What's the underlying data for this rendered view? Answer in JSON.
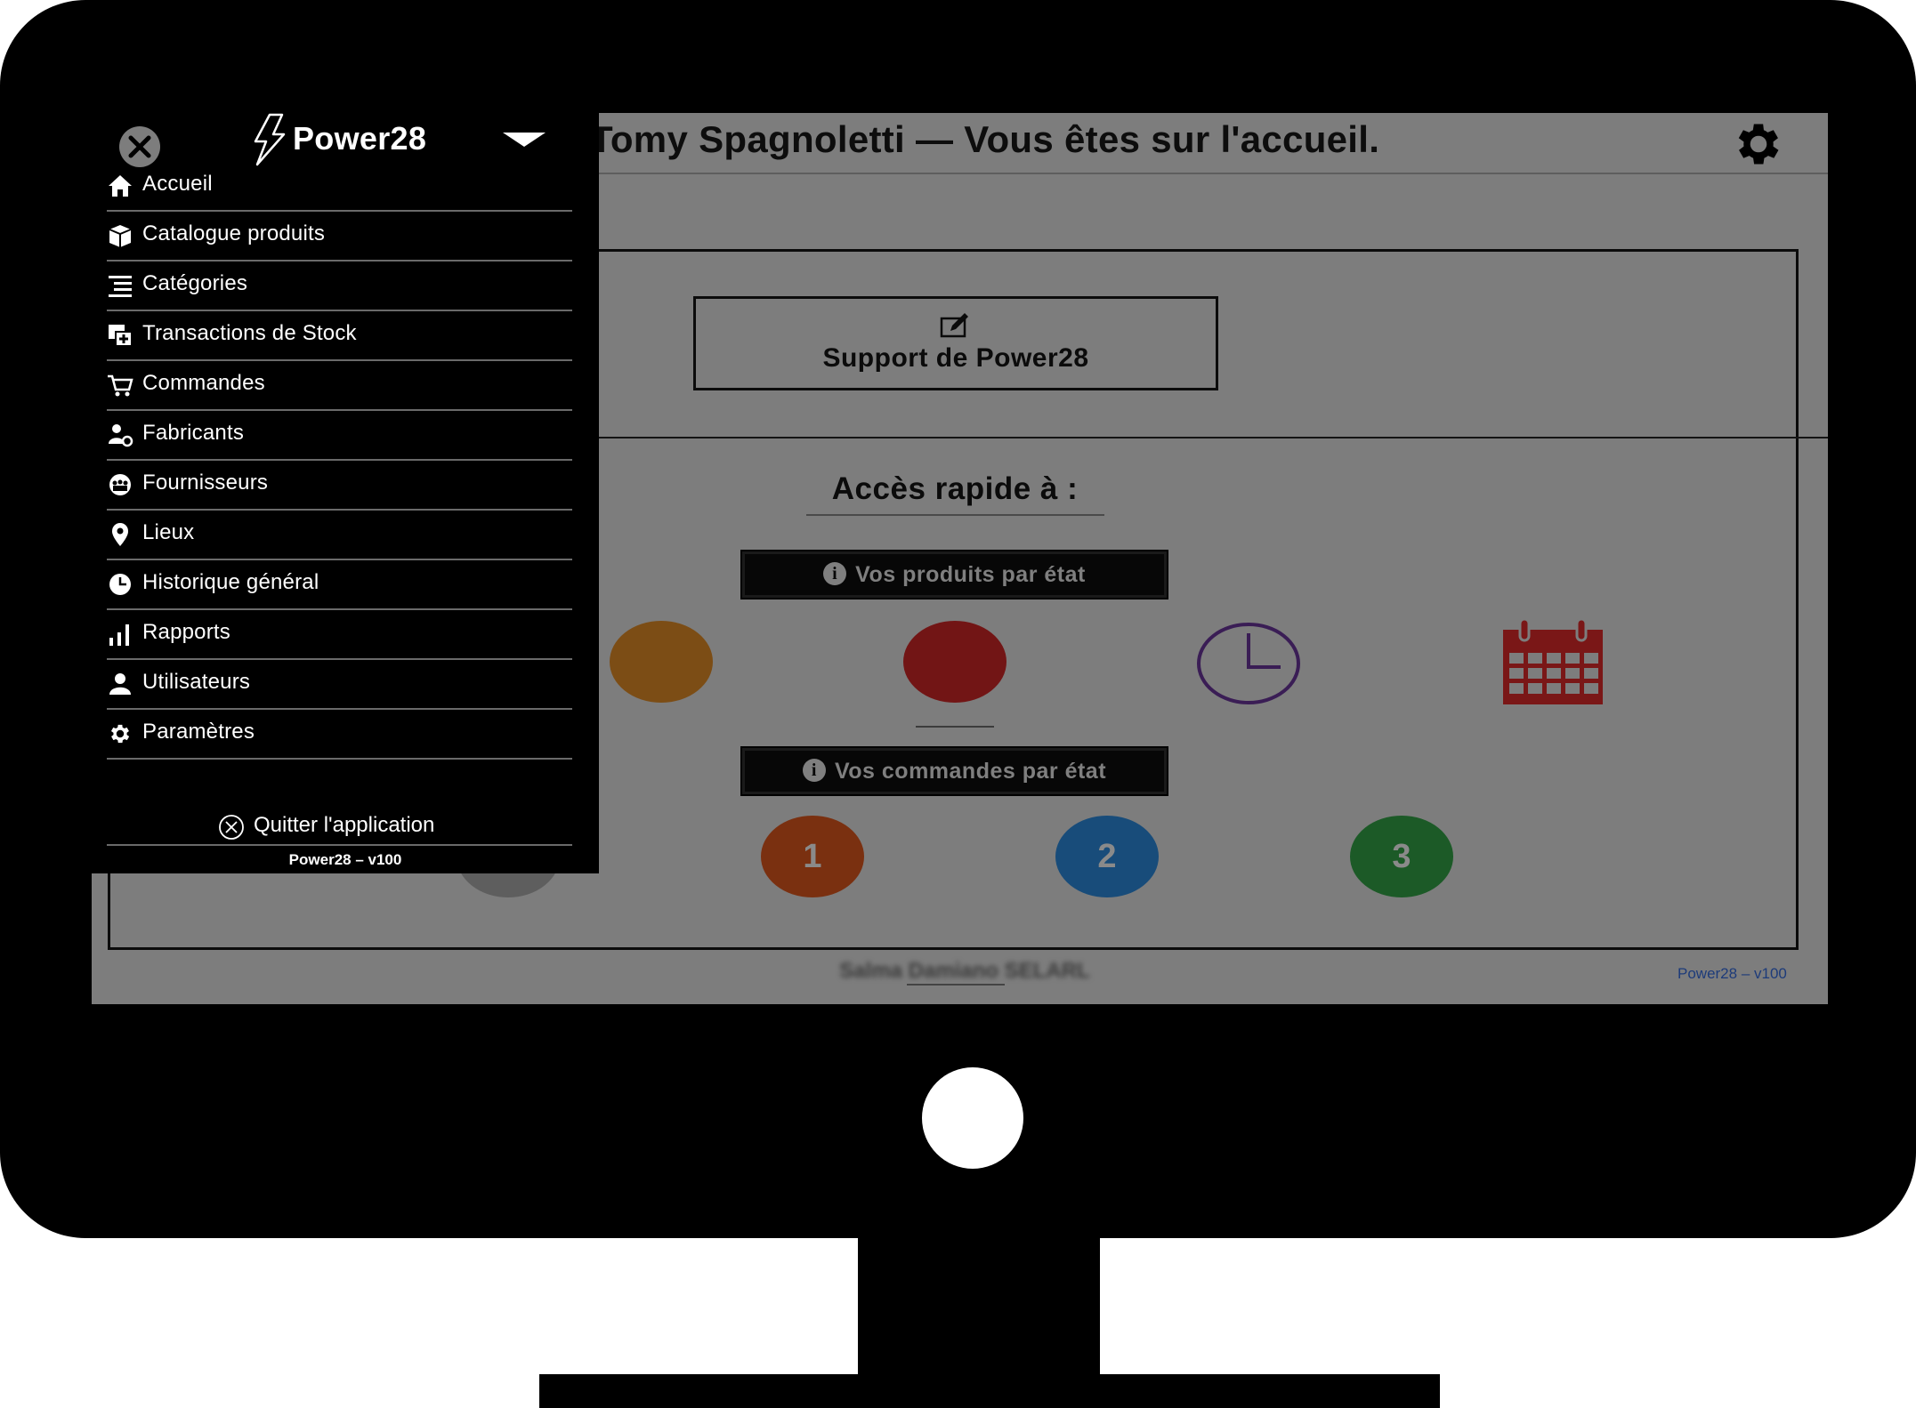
{
  "header": {
    "title": "Tomy Spagnoletti — Vous êtes sur l'accueil.",
    "settings_icon": "gear-icon"
  },
  "sidebar": {
    "brand": "Power28",
    "items": [
      {
        "label": "Accueil",
        "icon": "home-icon"
      },
      {
        "label": "Catalogue produits",
        "icon": "box-icon"
      },
      {
        "label": "Catégories",
        "icon": "list-icon"
      },
      {
        "label": "Transactions de Stock",
        "icon": "stock-transfer-icon"
      },
      {
        "label": "Commandes",
        "icon": "cart-icon"
      },
      {
        "label": "Fabricants",
        "icon": "manufacturer-icon"
      },
      {
        "label": "Fournisseurs",
        "icon": "supplier-icon"
      },
      {
        "label": "Lieux",
        "icon": "map-pin-icon"
      },
      {
        "label": "Historique général",
        "icon": "history-icon"
      },
      {
        "label": "Rapports",
        "icon": "bar-chart-icon"
      },
      {
        "label": "Utilisateurs",
        "icon": "user-icon"
      },
      {
        "label": "Paramètres",
        "icon": "gear-icon"
      }
    ],
    "quit_label": "Quitter l'application",
    "version": "Power28 – v100"
  },
  "main": {
    "support_label": "Support de Power28",
    "quick_access_title": "Accès rapide à :",
    "products_state_label": "Vos produits par état",
    "orders_state_label": "Vos commandes par état",
    "order_states": [
      "1",
      "2",
      "3"
    ],
    "footer_company": "Salma Damiano SELARL",
    "footer_version": "Power28 – v100"
  },
  "colors": {
    "state_orange": "#7c4d15",
    "state_red": "#721515",
    "clock_purple": "#3a1d55",
    "calendar_red": "#7a1717",
    "order_1": "#7a3010",
    "order_2": "#184c7a",
    "order_3": "#1c5a27"
  }
}
